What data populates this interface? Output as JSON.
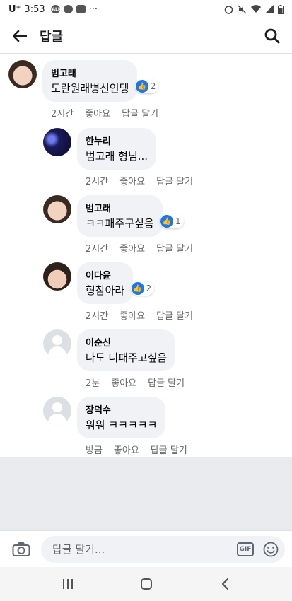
{
  "status_bar": {
    "carrier": "U⁺",
    "time": "3:53"
  },
  "header": {
    "title": "답글"
  },
  "comments": [
    {
      "name": "범고래",
      "text": "도란원래병신인뎅",
      "reaction_count": "2",
      "time": "2시간",
      "like": "좋아요",
      "reply": "답글 달기"
    },
    {
      "name": "한누리",
      "text": "범고래 형님...",
      "time": "2시간",
      "like": "좋아요",
      "reply": "답글 달기"
    },
    {
      "name": "범고래",
      "text": "ㅋㅋ패주구싶음",
      "reaction_count": "1",
      "time": "2시간",
      "like": "좋아요",
      "reply": "답글 달기"
    },
    {
      "name": "이다윤",
      "text": "형참아라",
      "reaction_count": "2",
      "time": "2시간",
      "like": "좋아요",
      "reply": "답글 달기"
    },
    {
      "name": "이순신",
      "text": "나도 너패주고싶음",
      "time": "2분",
      "like": "좋아요",
      "reply": "답글 달기"
    },
    {
      "name": "장덕수",
      "text": "워워 ㅋㅋㅋㅋㅋ",
      "time": "방금",
      "like": "좋아요",
      "reply": "답글 달기"
    }
  ],
  "composer": {
    "placeholder": "답글 달기...",
    "gif_label": "GIF"
  },
  "colors": {
    "accent": "#1877f2",
    "bubble": "#f0f2f5",
    "meta_text": "#65676b"
  }
}
